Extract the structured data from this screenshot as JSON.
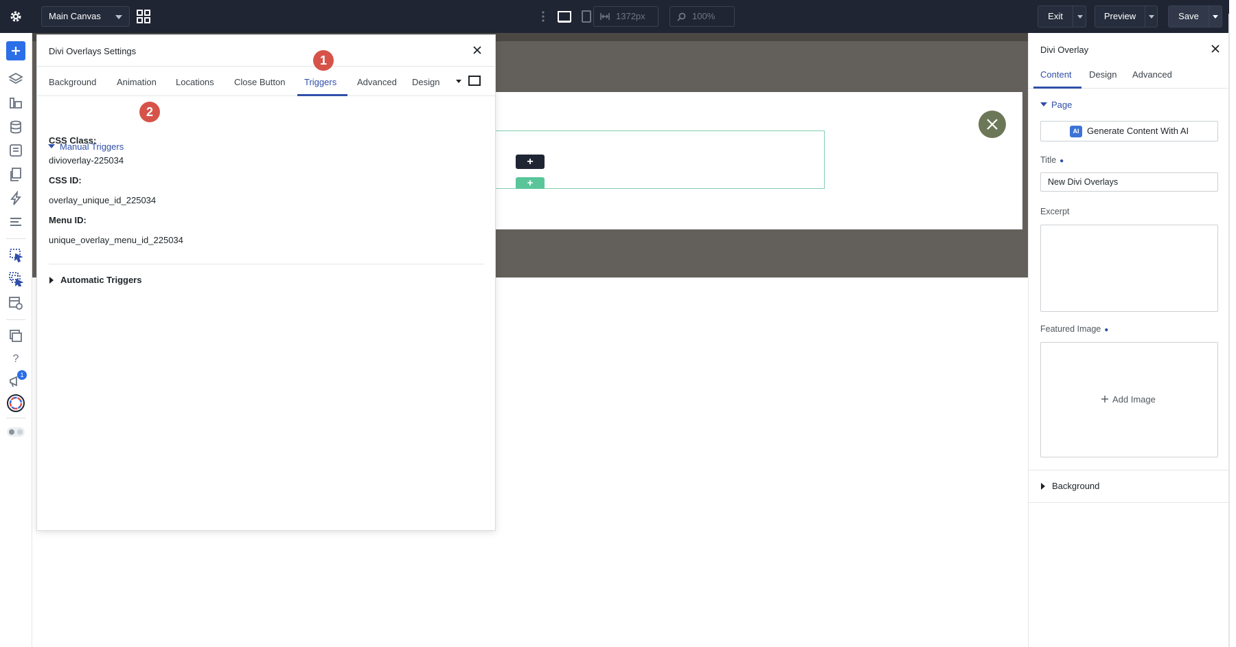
{
  "topbar": {
    "canvas_select": "Main Canvas",
    "width_value": "1372px",
    "zoom_value": "100%",
    "exit_label": "Exit",
    "preview_label": "Preview",
    "save_label": "Save"
  },
  "settings_modal": {
    "title": "Divi Overlays Settings",
    "tabs": [
      "Background",
      "Animation",
      "Locations",
      "Close Button",
      "Triggers",
      "Advanced",
      "Design"
    ],
    "active_tab": "Triggers",
    "badge_tabs": "1",
    "badge_section": "2",
    "manual_triggers": {
      "heading": "Manual Triggers",
      "css_class_label": "CSS Class:",
      "css_class_value": "divioverlay-225034",
      "css_id_label": "CSS ID:",
      "css_id_value": "overlay_unique_id_225034",
      "menu_id_label": "Menu ID:",
      "menu_id_value": "unique_overlay_menu_id_225034"
    },
    "automatic_triggers": "Automatic Triggers"
  },
  "canvas": {
    "add_buttons": [
      "+",
      "+"
    ]
  },
  "right_panel": {
    "title": "Divi Overlay",
    "tabs": [
      "Content",
      "Design",
      "Advanced"
    ],
    "active_tab": "Content",
    "page_section": "Page",
    "generate_ai": "Generate Content With AI",
    "ai_icon": "AI",
    "title_label": "Title",
    "title_value": "New Divi Overlays",
    "excerpt_label": "Excerpt",
    "excerpt_value": "",
    "featured_label": "Featured Image",
    "add_image": "Add Image",
    "background_section": "Background"
  },
  "rail": {
    "notification_count": "1"
  },
  "colors": {
    "topbar": "#1f2533",
    "accent": "#2f4fa8",
    "badge": "#d6534a",
    "add_blue": "#2b6ee8",
    "canvas_dark": "#635f5a",
    "row_outline": "#7fcfae"
  }
}
